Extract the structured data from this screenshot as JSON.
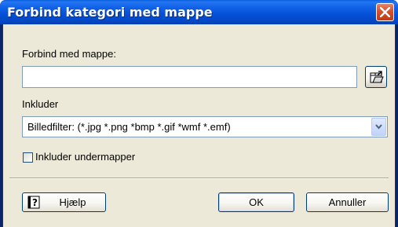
{
  "window": {
    "title": "Forbind kategori med mappe"
  },
  "folder": {
    "label": "Forbind med mappe:",
    "value": ""
  },
  "include": {
    "label": "Inkluder",
    "selected": "Billedfilter: (*.jpg *.png *bmp *.gif *wmf *.emf)"
  },
  "subfolders": {
    "label": "Inkluder undermapper",
    "checked": false
  },
  "buttons": {
    "help": "Hjælp",
    "ok": "OK",
    "cancel": "Annuller"
  },
  "colors": {
    "titlebar": "#0450d6",
    "client": "#ece9d8",
    "close": "#d5512c"
  }
}
